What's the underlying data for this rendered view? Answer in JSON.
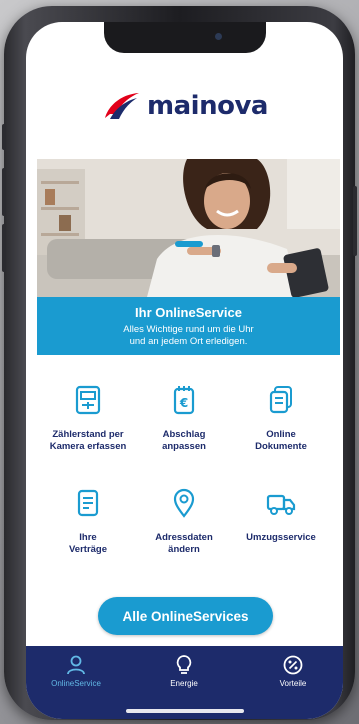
{
  "brand": {
    "name": "mainova"
  },
  "hero": {
    "title": "Ihr OnlineService",
    "subtitle_line1": "Alles Wichtige rund um die Uhr",
    "subtitle_line2": "und an jedem Ort erledigen."
  },
  "tiles": [
    {
      "line1": "Zählerstand per",
      "line2": "Kamera erfassen",
      "icon": "meter-icon"
    },
    {
      "line1": "Abschlag",
      "line2": "anpassen",
      "icon": "euro-document-icon"
    },
    {
      "line1": "Online",
      "line2": "Dokumente",
      "icon": "documents-icon"
    },
    {
      "line1": "Ihre",
      "line2": "Verträge",
      "icon": "contract-icon"
    },
    {
      "line1": "Adressdaten",
      "line2": "ändern",
      "icon": "location-pin-icon"
    },
    {
      "line1": "Umzugsservice",
      "line2": "",
      "icon": "moving-truck-icon"
    }
  ],
  "cta": {
    "label": "Alle OnlineServices"
  },
  "tabbar": [
    {
      "label": "OnlineService",
      "icon": "person-icon",
      "active": true
    },
    {
      "label": "Energie",
      "icon": "lightbulb-icon",
      "active": false
    },
    {
      "label": "Vorteile",
      "icon": "percent-badge-icon",
      "active": false
    }
  ],
  "colors": {
    "primary_blue": "#1a9bd0",
    "navy": "#1d2b6b",
    "brand_red": "#e2001a",
    "active_tab": "#62b9e6"
  }
}
